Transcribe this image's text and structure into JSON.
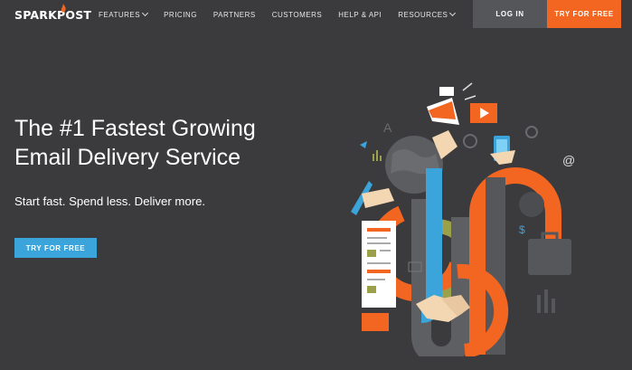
{
  "brand": {
    "name": "SPARKPOST"
  },
  "nav": {
    "items": [
      {
        "label": "FEATURES",
        "dropdown": true
      },
      {
        "label": "PRICING",
        "dropdown": false
      },
      {
        "label": "PARTNERS",
        "dropdown": false
      },
      {
        "label": "CUSTOMERS",
        "dropdown": false
      },
      {
        "label": "HELP & API",
        "dropdown": false
      },
      {
        "label": "RESOURCES",
        "dropdown": true
      }
    ],
    "login_label": "LOG IN",
    "try_label": "TRY FOR FREE"
  },
  "hero": {
    "headline_line1": "The #1 Fastest Growing",
    "headline_line2": "Email Delivery Service",
    "tagline": "Start fast. Spend less. Deliver more.",
    "cta_label": "TRY FOR FREE"
  },
  "illustration": {
    "at_symbol": "@",
    "dollar_symbol": "$",
    "a_symbol": "A"
  },
  "colors": {
    "background": "#3b3b3d",
    "accent_orange": "#f26622",
    "accent_blue": "#3aa4db",
    "login_gray": "#55565a",
    "olive": "#9aa14a"
  }
}
